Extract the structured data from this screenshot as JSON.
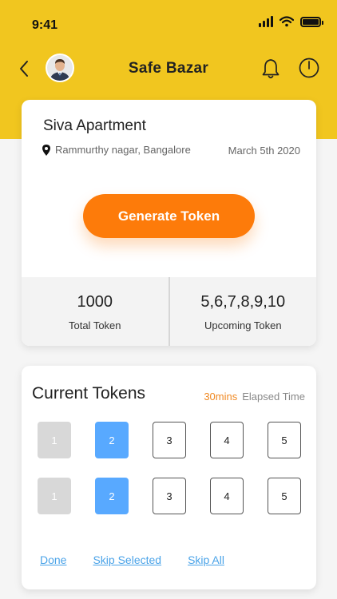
{
  "status_bar": {
    "time": "9:41"
  },
  "nav": {
    "title": "Safe Bazar",
    "avatar_icon": "user-avatar"
  },
  "apartment": {
    "name": "Siva Apartment",
    "location": "Rammurthy nagar, Bangalore",
    "date": "March 5th 2020"
  },
  "generate_button": {
    "label": "Generate Token"
  },
  "stats": {
    "total": {
      "value": "1000",
      "label": "Total Token"
    },
    "upcoming": {
      "value": "5,6,7,8,9,10",
      "label": "Upcoming Token"
    }
  },
  "current_tokens": {
    "title": "Current Tokens",
    "elapsed_value": "30mins",
    "elapsed_label": "Elapsed Time",
    "row1": [
      {
        "label": "1",
        "state": "done"
      },
      {
        "label": "2",
        "state": "selected"
      },
      {
        "label": "3",
        "state": "open"
      },
      {
        "label": "4",
        "state": "open"
      },
      {
        "label": "5",
        "state": "open"
      }
    ],
    "row2": [
      {
        "label": "1",
        "state": "done"
      },
      {
        "label": "2",
        "state": "selected"
      },
      {
        "label": "3",
        "state": "open"
      },
      {
        "label": "4",
        "state": "open"
      },
      {
        "label": "5",
        "state": "open"
      }
    ]
  },
  "actions": {
    "done": "Done",
    "skip_selected": "Skip Selected",
    "skip_all": "Skip All"
  },
  "colors": {
    "header": "#f1c61f",
    "primary_button": "#fd7b0a",
    "selected_token": "#58a9ff",
    "done_token": "#d8d8d8",
    "link": "#4aa3e8",
    "elapsed_accent": "#f08a24"
  }
}
